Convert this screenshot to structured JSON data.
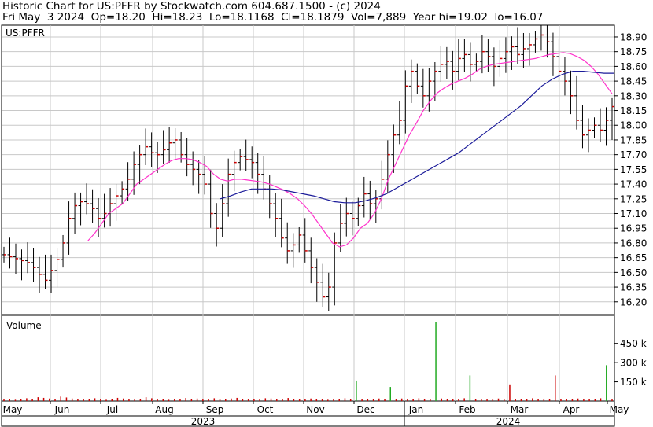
{
  "header": {
    "line1": "Historic Chart for US:PFFR by Stockwatch.com 604.687.1500 - (c) 2024",
    "line2": "Fri May  3 2024  Op=18.20  Hi=18.23  Lo=18.1168  Cl=18.1879  Vol=7,889  Year hi=19.02  lo=16.07"
  },
  "colors": {
    "grid": "#c8c8c8",
    "up_bar": "#000000",
    "close_tick": "#cc0000",
    "ma_short": "#ff33cc",
    "ma_long": "#1a1a99",
    "vol_normal": "#cc0000",
    "vol_up": "#22aa22"
  },
  "chart_data": [
    {
      "type": "ohlc",
      "title": "US:PFFR",
      "y_ticks": [
        16.2,
        16.35,
        16.5,
        16.65,
        16.8,
        16.95,
        17.1,
        17.25,
        17.4,
        17.55,
        17.7,
        17.85,
        18.0,
        18.15,
        18.3,
        18.45,
        18.6,
        18.75,
        18.9
      ],
      "ylim": [
        16.07,
        19.02
      ],
      "grid": true,
      "x_months": [
        "May",
        "Jun",
        "Jul",
        "Aug",
        "Sep",
        "Oct",
        "Nov",
        "Dec",
        "Jan",
        "Feb",
        "Mar",
        "Apr",
        "May"
      ],
      "years": [
        "2023",
        "2024"
      ],
      "series": [
        {
          "name": "close",
          "values": [
            16.68,
            16.66,
            16.64,
            16.62,
            16.6,
            16.55,
            16.48,
            16.42,
            16.52,
            16.63,
            16.8,
            17.05,
            17.18,
            17.22,
            17.2,
            17.15,
            17.05,
            17.1,
            17.2,
            17.28,
            17.35,
            17.45,
            17.6,
            17.7,
            17.78,
            17.72,
            17.7,
            17.75,
            17.82,
            17.85,
            17.7,
            17.6,
            17.55,
            17.5,
            17.4,
            17.1,
            16.95,
            17.2,
            17.5,
            17.62,
            17.68,
            17.65,
            17.62,
            17.5,
            17.35,
            17.2,
            17.05,
            16.85,
            16.72,
            16.78,
            16.88,
            16.72,
            16.55,
            16.4,
            16.25,
            16.35,
            16.8,
            17.0,
            17.1,
            17.05,
            17.18,
            17.3,
            17.2,
            17.25,
            17.45,
            17.7,
            17.9,
            18.05,
            18.4,
            18.55,
            18.4,
            18.3,
            18.45,
            18.55,
            18.62,
            18.65,
            18.55,
            18.68,
            18.72,
            18.62,
            18.65,
            18.75,
            18.7,
            18.6,
            18.68,
            18.75,
            18.8,
            18.72,
            18.78,
            18.82,
            18.88,
            18.92,
            18.85,
            18.7,
            18.55,
            18.45,
            18.3,
            18.05,
            17.9,
            17.95,
            18.0,
            17.95,
            18.05,
            18.19
          ]
        },
        {
          "name": "moving average (short)",
          "values": [
            null,
            null,
            null,
            null,
            null,
            null,
            null,
            null,
            null,
            null,
            null,
            null,
            16.82,
            16.9,
            17.0,
            17.1,
            17.15,
            17.2,
            17.3,
            17.4,
            17.45,
            17.5,
            17.55,
            17.6,
            17.64,
            17.66,
            17.66,
            17.65,
            17.62,
            17.58,
            17.5,
            17.45,
            17.43,
            17.45,
            17.45,
            17.44,
            17.43,
            17.42,
            17.4,
            17.37,
            17.34,
            17.3,
            17.25,
            17.18,
            17.1,
            17.0,
            16.9,
            16.8,
            16.76,
            16.78,
            16.85,
            16.95,
            17.0,
            17.1,
            17.25,
            17.45,
            17.6,
            17.75,
            17.9,
            18.02,
            18.15,
            18.25,
            18.33,
            18.38,
            18.42,
            18.45,
            18.48,
            18.52,
            18.57,
            18.6,
            18.62,
            18.63,
            18.64,
            18.65,
            18.66,
            18.67,
            18.68,
            18.7,
            18.72,
            18.73,
            18.74,
            18.73,
            18.7,
            18.66,
            18.6,
            18.52,
            18.42,
            18.32
          ]
        },
        {
          "name": "moving average (long)",
          "values": [
            17.25,
            17.28,
            17.32,
            17.35,
            17.35,
            17.35,
            17.34,
            17.32,
            17.3,
            17.28,
            17.25,
            17.22,
            17.21,
            17.21,
            17.23,
            17.26,
            17.3,
            17.36,
            17.42,
            17.48,
            17.54,
            17.6,
            17.66,
            17.72,
            17.8,
            17.88,
            17.96,
            18.04,
            18.12,
            18.2,
            18.3,
            18.4,
            18.47,
            18.52,
            18.55,
            18.55,
            18.54,
            18.53,
            18.53
          ]
        }
      ]
    },
    {
      "type": "bar",
      "title": "Volume",
      "y_ticks": [
        "150 k",
        "300 k",
        "450 k"
      ],
      "values": [
        12,
        18,
        10,
        15,
        22,
        16,
        30,
        25,
        20,
        18,
        35,
        28,
        20,
        15,
        12,
        18,
        22,
        14,
        10,
        16,
        25,
        20,
        15,
        12,
        18,
        30,
        22,
        16,
        14,
        10,
        12,
        18,
        24,
        15,
        20,
        12,
        16,
        22,
        18,
        14,
        20,
        25,
        16,
        12,
        18,
        15,
        22,
        20,
        14,
        16,
        24,
        18,
        12,
        15,
        20,
        16,
        12,
        10,
        18,
        14,
        22,
        16,
        160,
        12,
        18,
        15,
        20,
        14,
        110,
        12,
        20,
        18,
        16,
        22,
        14,
        18,
        620,
        20,
        15,
        12,
        16,
        22,
        200,
        14,
        18,
        12,
        16,
        20,
        12,
        130,
        18,
        16,
        14,
        22,
        18,
        12,
        16,
        200,
        15,
        18,
        14,
        20,
        12,
        16,
        18,
        22,
        280,
        12
      ]
    }
  ]
}
